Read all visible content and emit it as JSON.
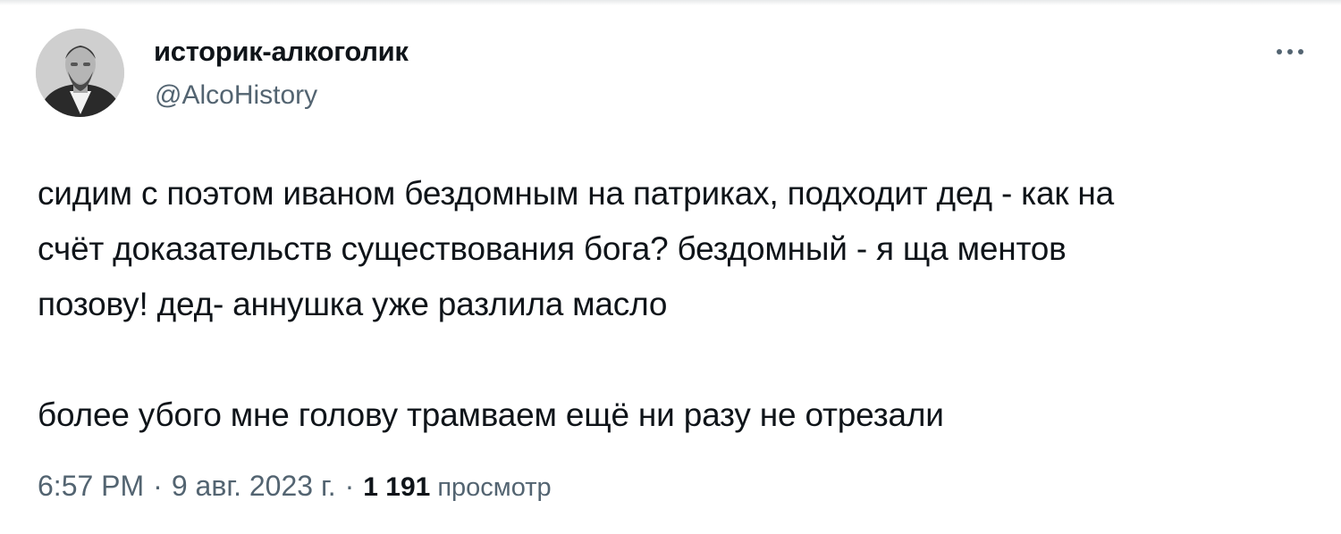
{
  "author": {
    "display_name": "историк-алкоголик",
    "handle": "@AlcoHistory",
    "avatar_icon": "portrait-photo"
  },
  "menu": {
    "more_icon": "more-horizontal-icon"
  },
  "tweet": {
    "paragraph_1_lines": [
      "сидим с поэтом иваном бездомным на патриках, подходит дед - как на",
      "счёт доказательств существования бога? бездомный - я ща ментов",
      "позову! дед- аннушка уже разлила масло"
    ],
    "paragraph_2": "более убого мне голову трамваем ещё ни разу не отрезали"
  },
  "meta": {
    "time": "6:57 PM",
    "separator": "·",
    "date": "9 авг. 2023 г.",
    "views_count": "1 191",
    "views_label": "просмотр"
  },
  "colors": {
    "text_primary": "#0f1419",
    "text_secondary": "#536471",
    "background": "#ffffff"
  }
}
